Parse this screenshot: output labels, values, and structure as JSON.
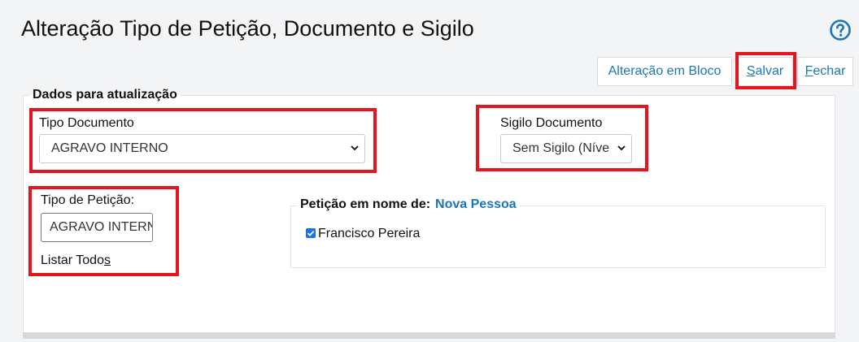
{
  "page": {
    "title": "Alteração Tipo de Petição, Documento e Sigilo",
    "help_icon": "help-circle-icon"
  },
  "toolbar": {
    "bulk_label": "Alteração em Bloco",
    "save_label_first": "S",
    "save_label_rest": "alvar",
    "close_label_first": "F",
    "close_label_rest": "echar"
  },
  "form": {
    "section_title": "Dados para atualização",
    "tipo_documento": {
      "label": "Tipo Documento",
      "value": "AGRAVO INTERNO"
    },
    "sigilo_documento": {
      "label": "Sigilo Documento",
      "value": "Sem Sigilo (Níve"
    },
    "tipo_peticao": {
      "label": "Tipo de Petição:",
      "value": "AGRAVO INTERNO",
      "list_all_prefix": "Listar Todo",
      "list_all_underlined": "s"
    },
    "peticao_nome": {
      "label": "Petição em nome de:",
      "new_person_link": "Nova Pessoa",
      "persons": [
        {
          "name": "Francisco Pereira",
          "checked": true
        }
      ]
    }
  },
  "colors": {
    "accent": "#1b76b8",
    "highlight": "#e3161f",
    "checkbox": "#1a73e8"
  }
}
